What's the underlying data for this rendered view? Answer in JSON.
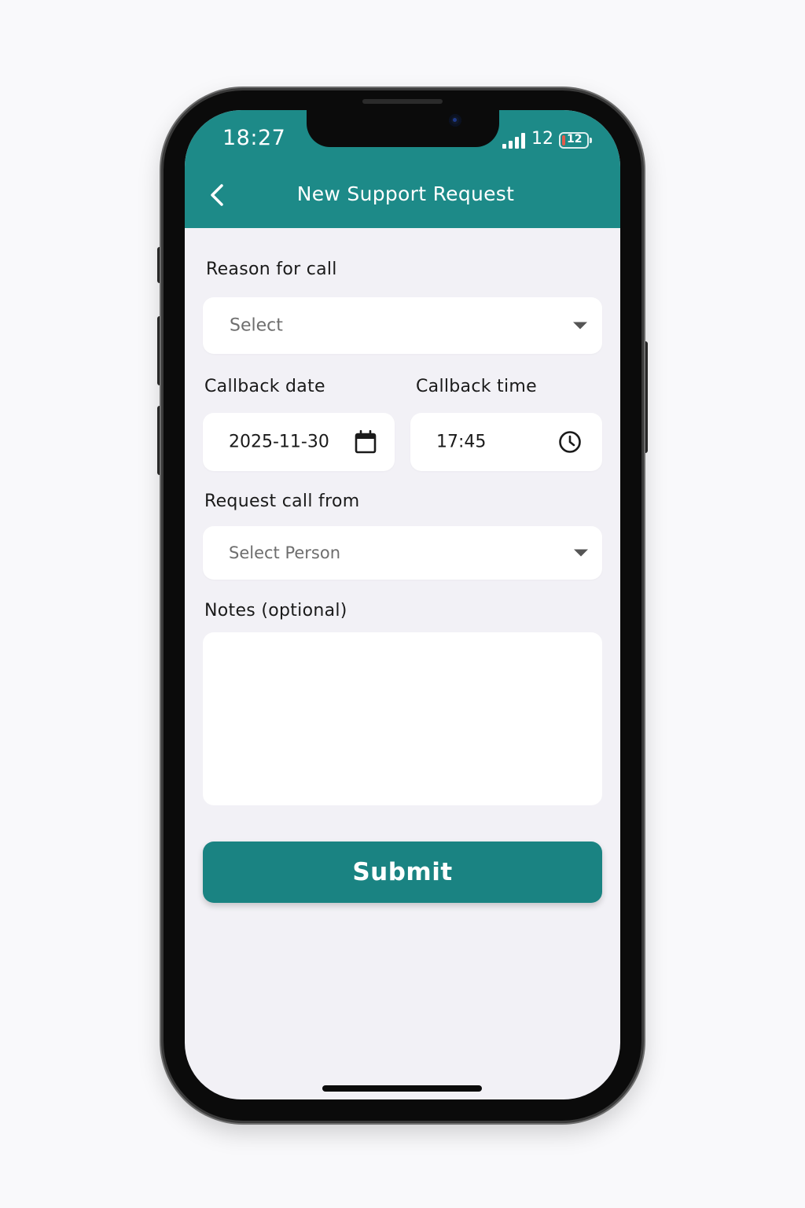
{
  "status_bar": {
    "time": "18:27",
    "signal_label": "12",
    "battery_label": "12",
    "battery_level": 0.12,
    "battery_color": "#e25b4b"
  },
  "header": {
    "title": "New Support Request",
    "background": "#1d8a88"
  },
  "form": {
    "reason": {
      "label": "Reason for call",
      "value": "Select"
    },
    "callback_date": {
      "label": "Callback date",
      "value": "2025-11-30"
    },
    "callback_time": {
      "label": "Callback time",
      "value": "17:45"
    },
    "request_from": {
      "label": "Request call from",
      "value": "Select Person"
    },
    "notes": {
      "label": "Notes (optional)",
      "value": ""
    },
    "submit_label": "Submit",
    "accent": "#1a8382"
  }
}
